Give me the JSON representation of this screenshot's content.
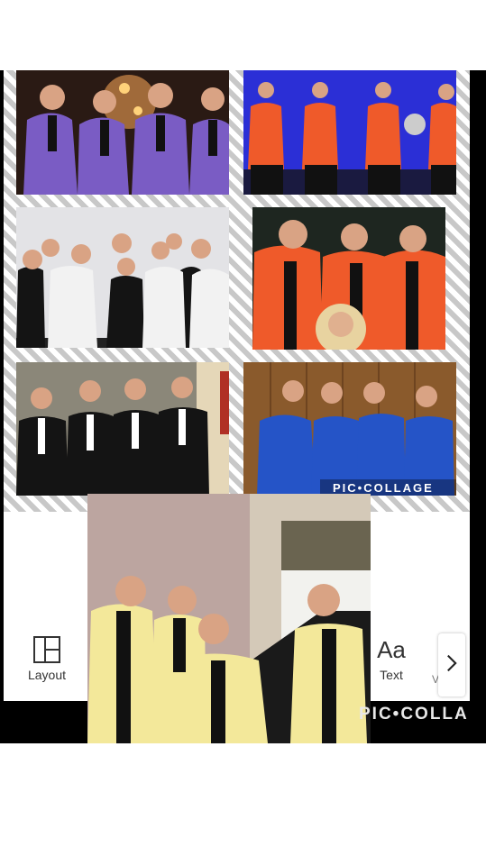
{
  "toolbar": {
    "layout_label": "Layout",
    "text_label": "Text",
    "text_icon_glyph": "Aa",
    "partial_label": "V",
    "icons": [
      "layout-icon",
      "text-icon",
      "chevron-right-icon"
    ]
  },
  "watermarks": {
    "collage_main": "PIC•COLLAGE",
    "collage_overlay": "PIC•COLLA"
  },
  "colors": {
    "purple_jacket": "#7a5cc4",
    "orange_jacket": "#ef5a2a",
    "white_jacket": "#f2f2f2",
    "black_jacket": "#141414",
    "blue_jacket": "#2554c7",
    "yellow_jacket": "#f3e89a",
    "stage_blue": "#2b2fd6"
  }
}
